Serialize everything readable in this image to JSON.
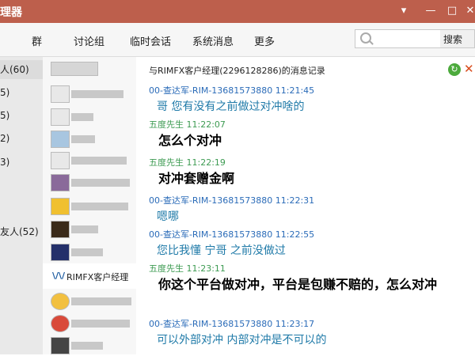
{
  "window": {
    "title": "理器",
    "min": "▾",
    "restore": "—",
    "max": "□",
    "close": "✕"
  },
  "toolbar": {
    "tabs": [
      "群",
      "讨论组",
      "临时会话",
      "系统消息",
      "更多"
    ],
    "search_placeholder": "",
    "search_button": "搜索"
  },
  "groups": [
    {
      "label": "人(60)"
    },
    {
      "label": "5)"
    },
    {
      "label": "5)"
    },
    {
      "label": "2)"
    },
    {
      "label": "3)"
    },
    {
      "label": "友人(52)"
    }
  ],
  "contacts": {
    "selected": {
      "avatar_text": "\\/\\/",
      "name": "RIMFX客户经理"
    }
  },
  "chat": {
    "title": "与RIMFX客户经理(2296128286)的消息记录",
    "messages": [
      {
        "sender": "00-查达军-RIM-13681573880 11:21:45",
        "color": "blue",
        "text": "哥 您有没有之前做过对冲啥的",
        "bold": false
      },
      {
        "sender": "五度先生 11:22:07",
        "color": "green",
        "text": "怎么个对冲",
        "bold": true
      },
      {
        "sender": "五度先生 11:22:19",
        "color": "green",
        "text": "对冲套赠金啊",
        "bold": true
      },
      {
        "sender": "00-查达军-RIM-13681573880 11:22:31",
        "color": "blue",
        "text": "嗯哪",
        "bold": false
      },
      {
        "sender": "00-查达军-RIM-13681573880 11:22:55",
        "color": "blue",
        "text": "您比我懂 宁哥 之前没做过",
        "bold": false
      },
      {
        "sender": "五度先生 11:23:11",
        "color": "green",
        "text": "你这个平台做对冲，平台是包赚不赔的，怎么对冲",
        "bold": true
      },
      {
        "sender": "00-查达军-RIM-13681573880 11:23:17",
        "color": "blue",
        "text": "可以外部对冲  内部对冲是不可以的",
        "bold": false
      }
    ]
  },
  "icons": {
    "refresh": "refresh-icon",
    "close": "close-icon",
    "search": "search-icon"
  }
}
